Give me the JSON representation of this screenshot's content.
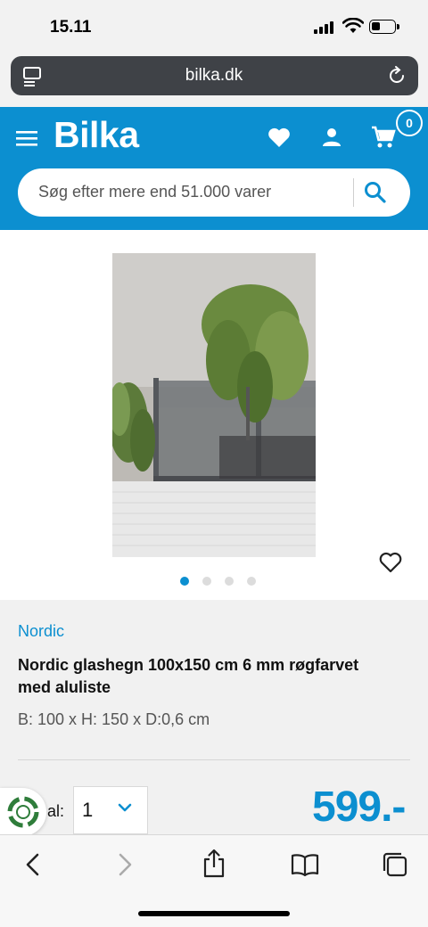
{
  "status_bar": {
    "time": "15.11"
  },
  "browser": {
    "url": "bilka.dk"
  },
  "header": {
    "logo": "Bilka",
    "cart_count": "0",
    "search_placeholder": "Søg efter mere end 51.000 varer"
  },
  "product": {
    "image_count": 4,
    "active_image": 1,
    "brand": "Nordic",
    "title": "Nordic glashegn 100x150 cm 6 mm røgfarvet med aluliste",
    "dimensions": "B: 100 x H: 150 x D:0,6 cm",
    "quantity_label": "al:",
    "quantity_value": "1",
    "price": "599.-"
  },
  "colors": {
    "brand_blue": "#0c8fd0",
    "url_bar": "#3f4247"
  },
  "icons": [
    "tabs-icon",
    "reload-icon",
    "menu-icon",
    "heart-icon",
    "user-icon",
    "cart-icon",
    "search-icon",
    "wishlist-heart-icon",
    "chevron-down-icon",
    "eco-icon",
    "back-icon",
    "forward-icon",
    "share-icon",
    "bookmarks-icon",
    "tabs-overview-icon"
  ]
}
